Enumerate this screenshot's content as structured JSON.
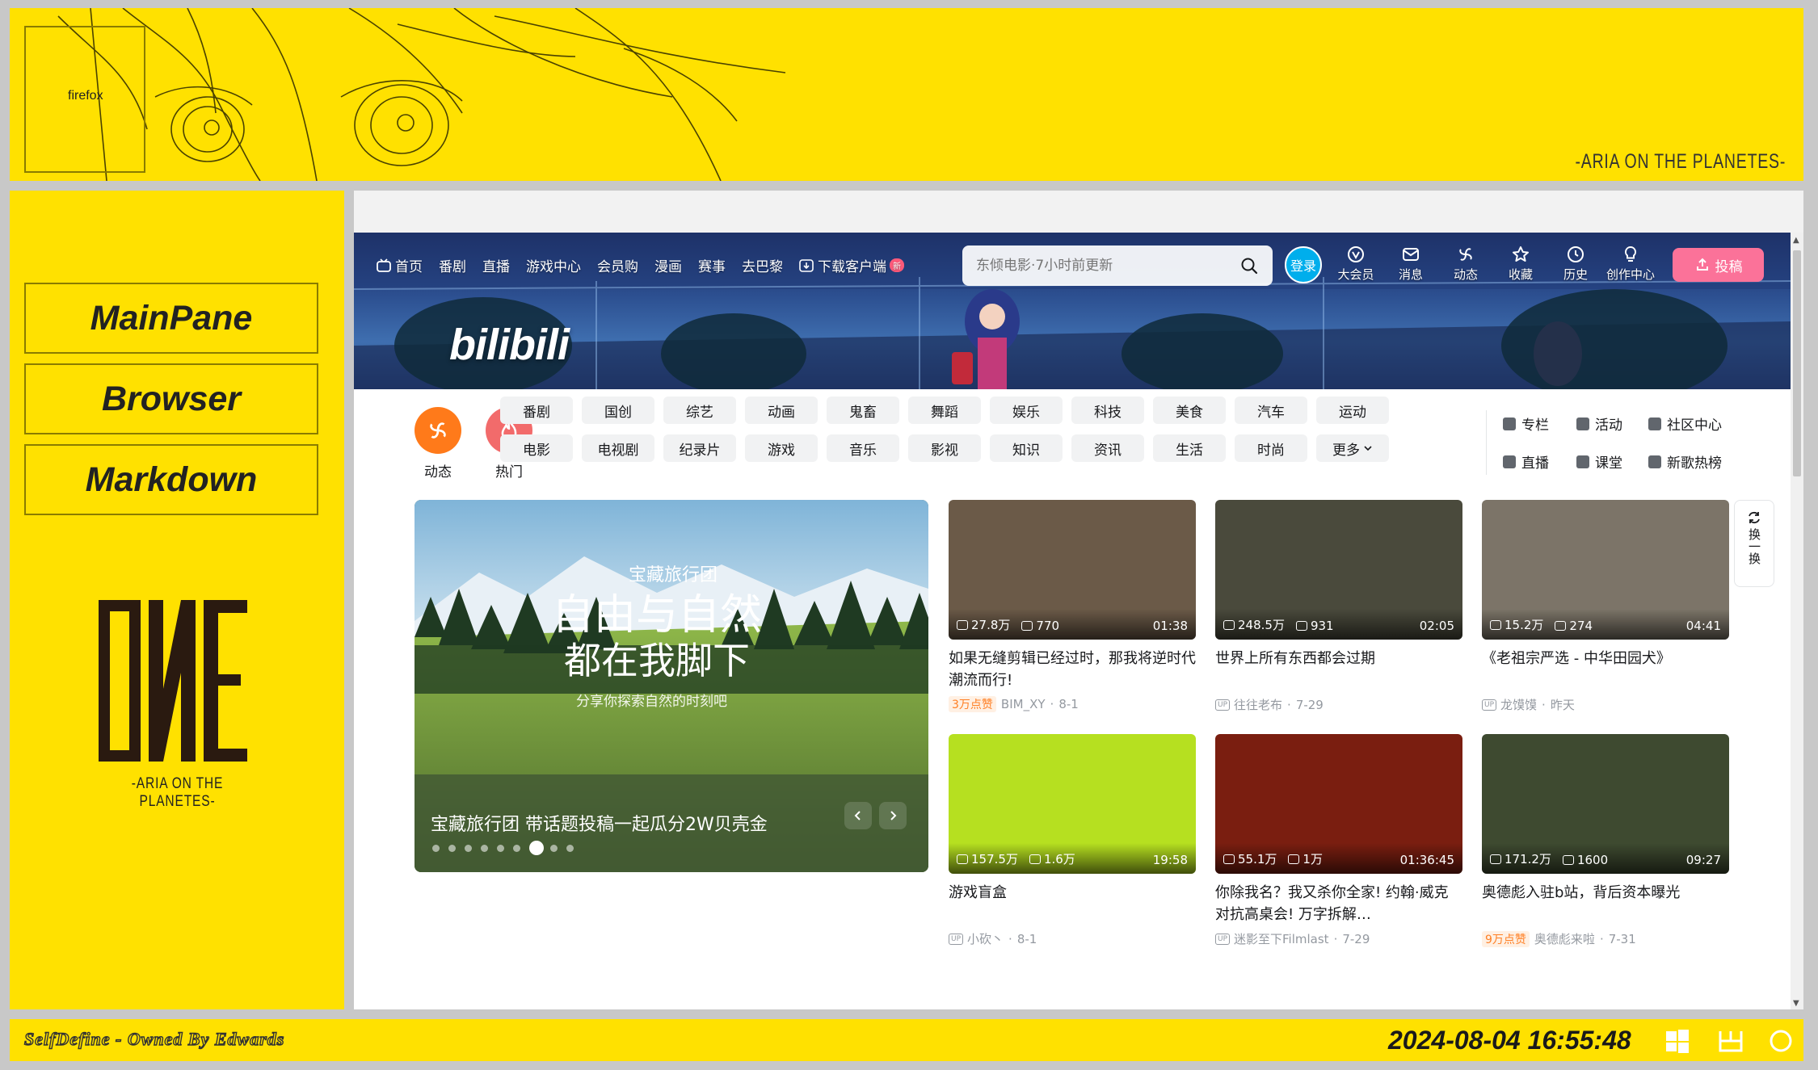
{
  "desktop": {
    "top_banner": {
      "window_label": "firefox",
      "caption": "-ARIA ON THE PLANETES-"
    },
    "left_panel": {
      "buttons": [
        "MainPane",
        "Browser",
        "Markdown"
      ],
      "logo_text": "ONE",
      "logo_caption": "-ARIA ON THE PLANETES-"
    },
    "taskbar": {
      "owner_text": "SelfDefine - Owned By Edwards",
      "clock": "2024-08-04 16:55:48",
      "icons": [
        "windows-icon",
        "layout-icon",
        "circle-icon"
      ]
    }
  },
  "bilibili": {
    "nav": {
      "items": [
        "首页",
        "番剧",
        "直播",
        "游戏中心",
        "会员购",
        "漫画",
        "赛事",
        "去巴黎",
        "下载客户端"
      ],
      "new_badge": "新"
    },
    "search": {
      "placeholder": "东倾电影·7小时前更新"
    },
    "login_label": "登录",
    "right_entries": [
      "大会员",
      "消息",
      "动态",
      "收藏",
      "历史",
      "创作中心"
    ],
    "upload_label": "投稿",
    "logo_text": "bilibili",
    "channels": {
      "primary": [
        {
          "label": "动态",
          "color": "#ff7a1a",
          "icon": "dynamic-icon"
        },
        {
          "label": "热门",
          "color": "#f26b6b",
          "icon": "fire-icon"
        }
      ],
      "row1": [
        "番剧",
        "国创",
        "综艺",
        "动画",
        "鬼畜",
        "舞蹈",
        "娱乐",
        "科技",
        "美食",
        "汽车",
        "运动"
      ],
      "row2": [
        "电影",
        "电视剧",
        "纪录片",
        "游戏",
        "音乐",
        "影视",
        "知识",
        "资讯",
        "生活",
        "时尚",
        "更多"
      ],
      "side_links_row1": [
        "专栏",
        "活动",
        "社区中心"
      ],
      "side_links_row2": [
        "直播",
        "课堂",
        "新歌热榜"
      ]
    },
    "carousel": {
      "title": "宝藏旅行团 带话题投稿一起瓜分2W贝壳金",
      "dots": 9,
      "active_dot": 6
    },
    "refresh_label": "换一换",
    "videos": [
      {
        "views": "27.8万",
        "danmaku": "770",
        "duration": "01:38",
        "title": "如果无缝剪辑已经过时，那我将逆时代潮流而行!",
        "likes_badge": "3万点赞",
        "author": "BIM_XY",
        "date": "8-1",
        "thumb": "#6b5a48"
      },
      {
        "views": "248.5万",
        "danmaku": "931",
        "duration": "02:05",
        "title": "世界上所有东西都会过期",
        "likes_badge": "",
        "author": "往往老布",
        "date": "7-29",
        "thumb": "#4a4a3c"
      },
      {
        "views": "15.2万",
        "danmaku": "274",
        "duration": "04:41",
        "title": "《老祖宗严选 - 中华田园犬》",
        "likes_badge": "",
        "author": "龙馍馍",
        "date": "昨天",
        "thumb": "#7c7468"
      },
      {
        "views": "157.5万",
        "danmaku": "1.6万",
        "duration": "19:58",
        "title": "游戏盲盒",
        "likes_badge": "",
        "author": "小砍丶",
        "date": "8-1",
        "thumb": "#b6e020"
      },
      {
        "views": "55.1万",
        "danmaku": "1万",
        "duration": "01:36:45",
        "title": "你除我名？我又杀你全家! 约翰·威克对抗高桌会! 万字拆解…",
        "likes_badge": "",
        "author": "迷影至下Filmlast",
        "date": "7-29",
        "thumb": "#7a1e10"
      },
      {
        "views": "171.2万",
        "danmaku": "1600",
        "duration": "09:27",
        "title": "奥德彪入驻b站，背后资本曝光",
        "likes_badge": "9万点赞",
        "author": "奥德彪来啦",
        "date": "7-31",
        "thumb": "#3e4a30"
      }
    ]
  }
}
